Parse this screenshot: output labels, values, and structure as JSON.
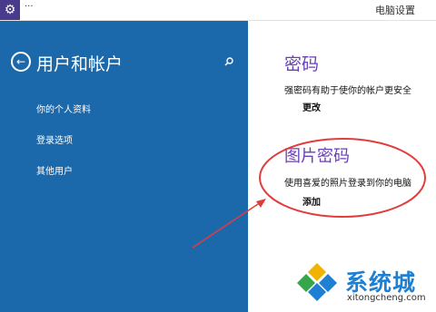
{
  "window": {
    "title": "电脑设置",
    "menu_dots": "···"
  },
  "sidebar": {
    "title": "用户和帐户",
    "items": [
      {
        "label": "你的个人资料"
      },
      {
        "label": "登录选项"
      },
      {
        "label": "其他用户"
      }
    ]
  },
  "main": {
    "password": {
      "title": "密码",
      "desc": "强密码有助于使你的帐户更安全",
      "action": "更改"
    },
    "picture_password": {
      "title": "图片密码",
      "desc": "使用喜爱的照片登录到你的电脑",
      "action": "添加"
    }
  },
  "watermark": {
    "text": "系统城",
    "url": "xitongcheng.com"
  },
  "colors": {
    "sidebar": "#1b69ab",
    "accent": "#6a3fb5",
    "annotation": "#e23c3c",
    "titlebar_icon": "#4a3a8c"
  },
  "icons": {
    "app": "gear-icon",
    "back": "back-arrow-icon",
    "search": "search-icon"
  }
}
